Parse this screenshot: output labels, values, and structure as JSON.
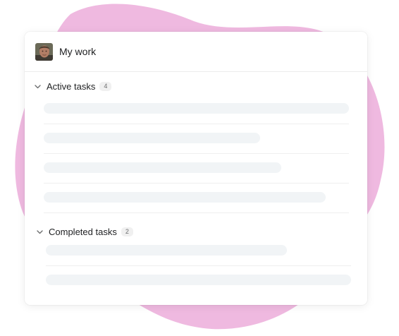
{
  "card": {
    "title": "My work"
  },
  "sections": [
    {
      "title": "Active tasks",
      "count": "4"
    },
    {
      "title": "Completed tasks",
      "count": "2"
    }
  ],
  "colors": {
    "blob": "#efb9e0",
    "skeleton": "#f1f4f6",
    "divider": "#efefef"
  },
  "icons": {
    "collapse": "chevron-down-icon"
  }
}
